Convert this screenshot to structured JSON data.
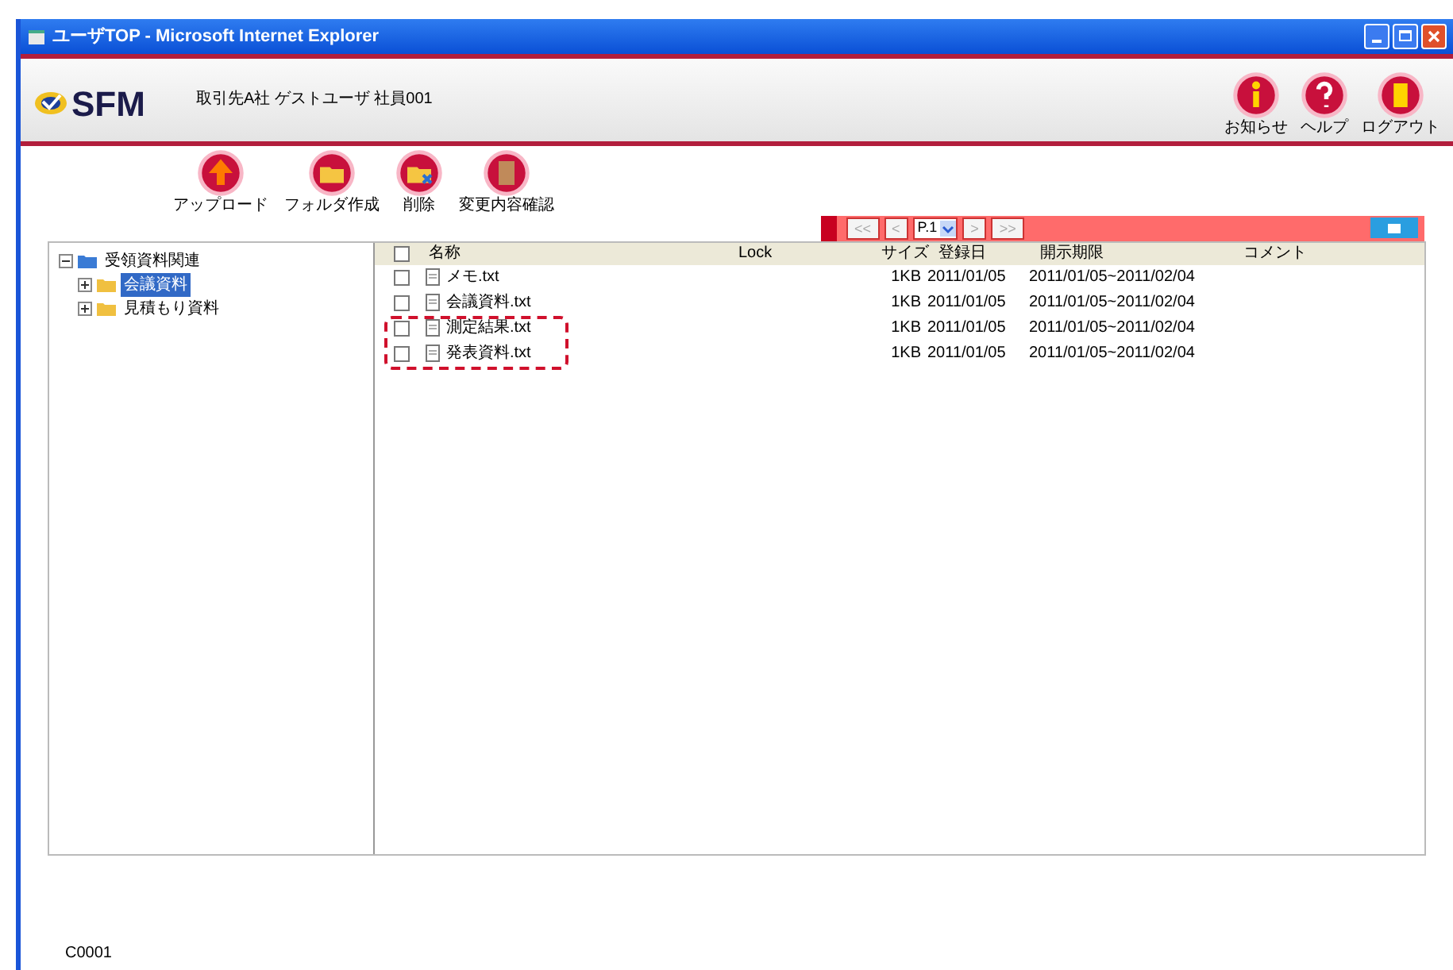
{
  "window": {
    "title": "ユーザTOP - Microsoft Internet Explorer"
  },
  "header": {
    "logo": "SFM",
    "user": "取引先A社 ゲストユーザ 社員001"
  },
  "toolbar": [
    {
      "label": "アップロード",
      "kind": "upload"
    },
    {
      "label": "フォルダ作成",
      "kind": "folder"
    },
    {
      "label": "削除",
      "kind": "delete"
    },
    {
      "label": "変更内容確認",
      "kind": "review"
    }
  ],
  "top_actions": [
    {
      "label": "お知らせ",
      "kind": "info"
    },
    {
      "label": "ヘルプ",
      "kind": "help"
    },
    {
      "label": "ログアウト",
      "kind": "logout"
    }
  ],
  "pager": {
    "first": "<<",
    "prev": "<",
    "page": "P.1",
    "next": ">",
    "last": ">>"
  },
  "tree": [
    {
      "label": "受領資料関連",
      "expanded": true,
      "selected": false,
      "children": [
        {
          "label": "会議資料",
          "expanded": false,
          "selected": true
        },
        {
          "label": "見積もり資料",
          "expanded": false,
          "selected": false
        }
      ]
    }
  ],
  "table": {
    "all_checked": false,
    "columns": [
      "名称",
      "Lock",
      "サイズ",
      "登録日",
      "開示期限",
      "コメント"
    ],
    "rows": [
      {
        "name": "メモ.txt",
        "size": "1KB",
        "date": "2011/01/05",
        "period": "2011/01/05~2011/02/04",
        "checked": false,
        "highlighted": false
      },
      {
        "name": "会議資料.txt",
        "size": "1KB",
        "date": "2011/01/05",
        "period": "2011/01/05~2011/02/04",
        "checked": false,
        "highlighted": false
      },
      {
        "name": "測定結果.txt",
        "size": "1KB",
        "date": "2011/01/05",
        "period": "2011/01/05~2011/02/04",
        "checked": false,
        "highlighted": true
      },
      {
        "name": "発表資料.txt",
        "size": "1KB",
        "date": "2011/01/05",
        "period": "2011/01/05~2011/02/04",
        "checked": false,
        "highlighted": true
      }
    ]
  },
  "footer": {
    "code": "C0001"
  }
}
